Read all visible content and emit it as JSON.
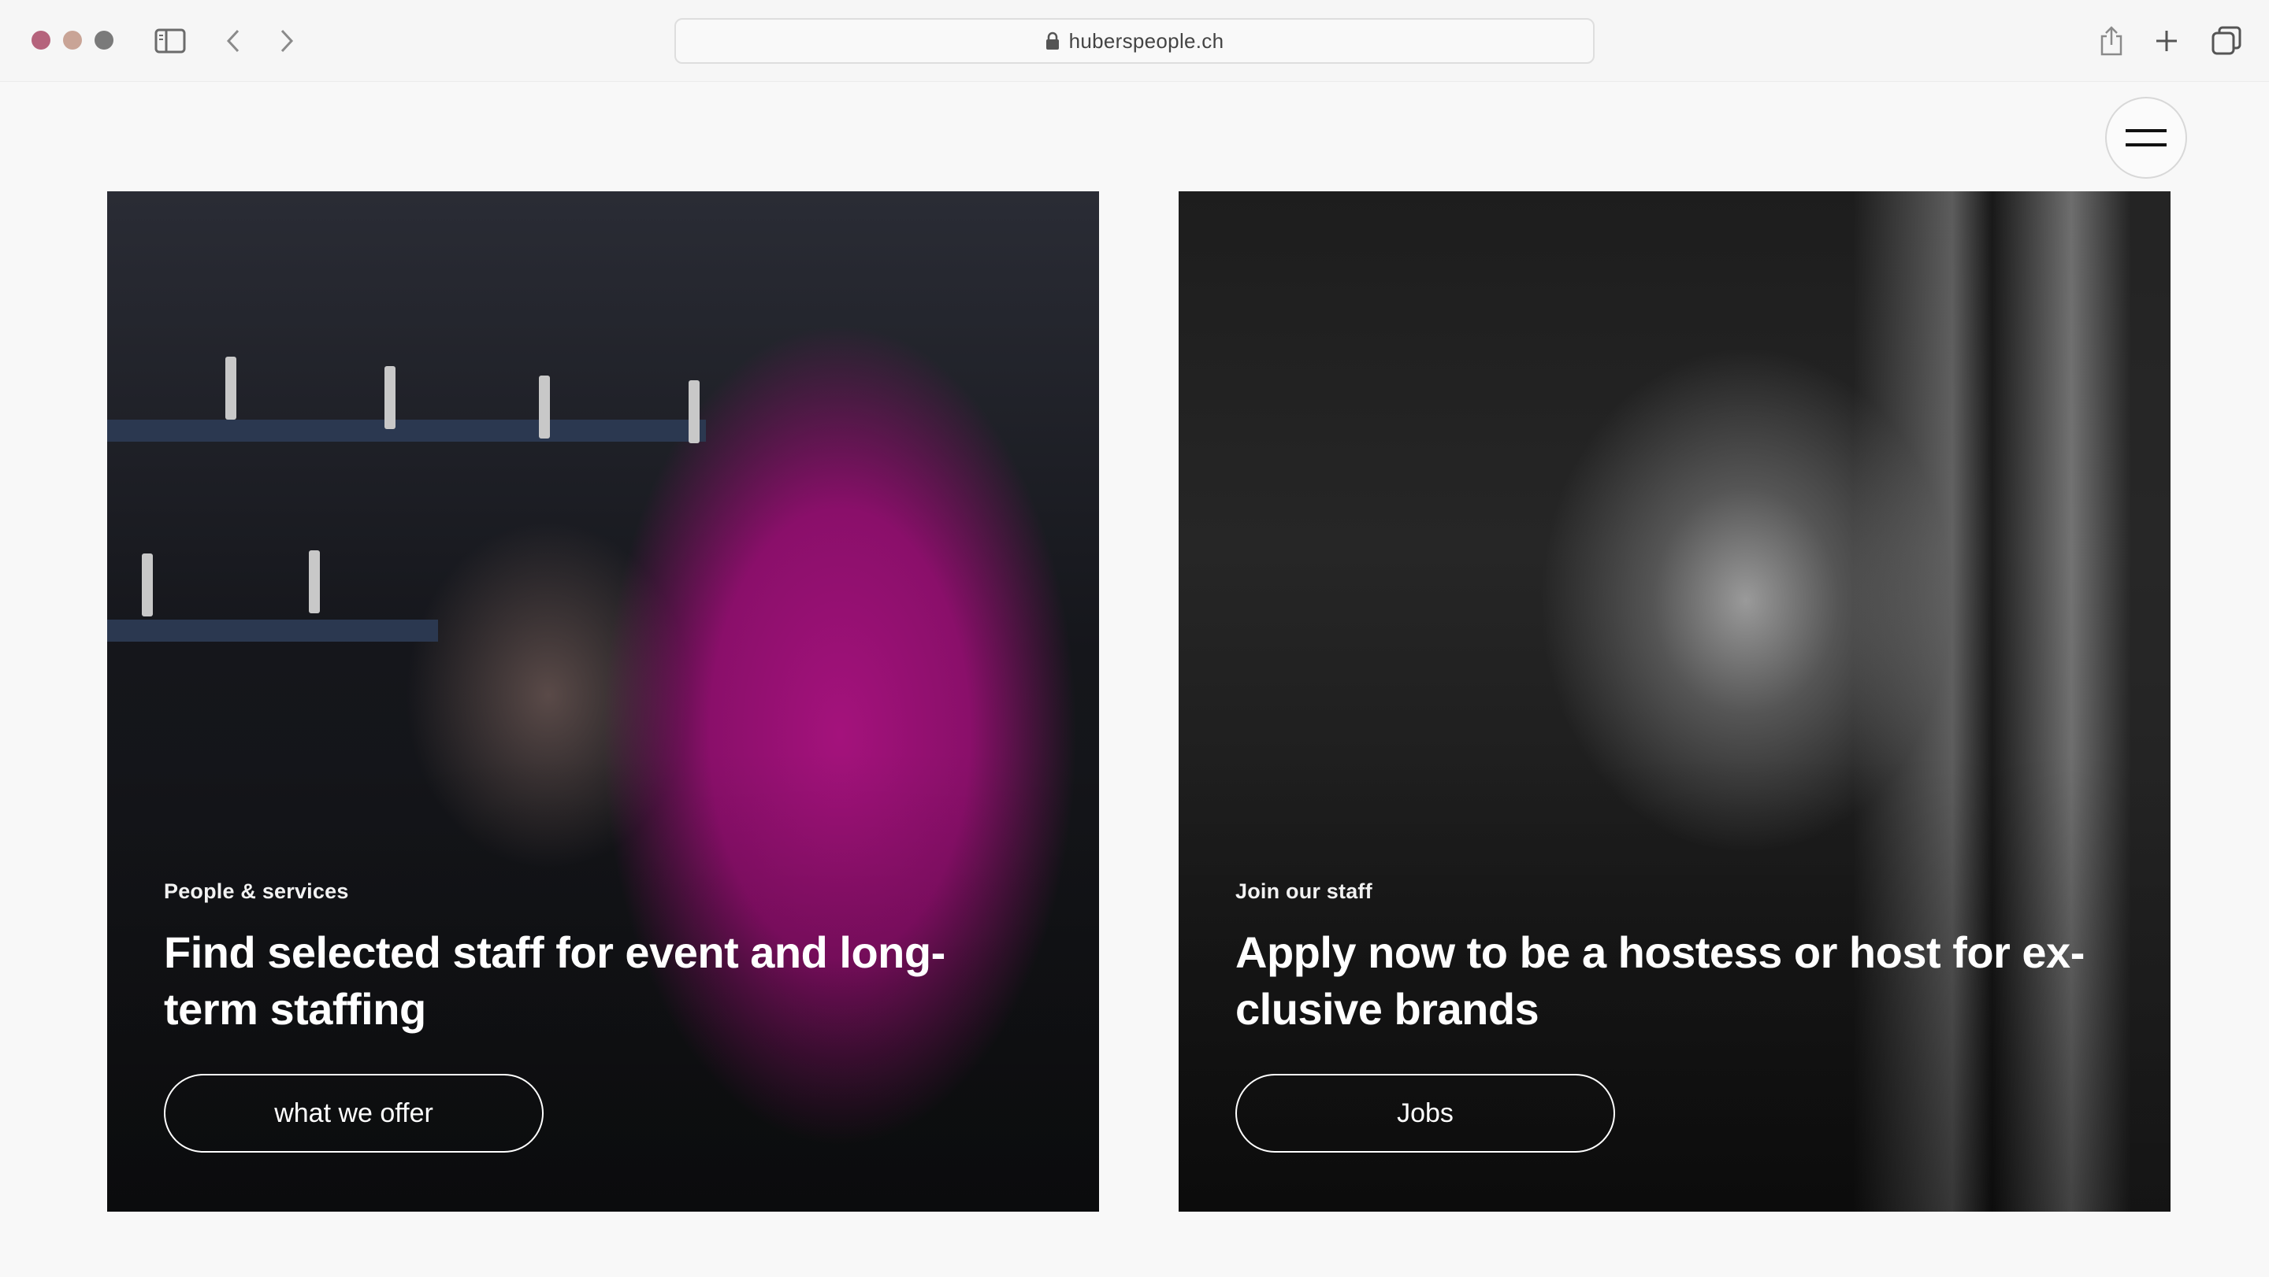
{
  "browser": {
    "url": "huberspeople.ch",
    "traffic_lights": [
      "close",
      "minimize",
      "maximize"
    ],
    "icons": {
      "sidebar": "sidebar-icon",
      "back": "chevron-left-icon",
      "forward": "chevron-right-icon",
      "lock": "lock-icon",
      "share": "share-icon",
      "new_tab": "plus-icon",
      "tabs": "tabs-overview-icon"
    }
  },
  "header": {
    "menu_icon": "hamburger-menu-icon"
  },
  "cards": [
    {
      "eyebrow": "People & services",
      "title": "Find selected staff for event and long-term staffing",
      "cta": "what we offer",
      "image": "woman holding magenta coat at clothing rack"
    },
    {
      "eyebrow": "Join our staff",
      "title": "Apply now to be a hostess or host for ex-clusive brands",
      "cta": "Jobs",
      "image": "man on phone, black and white"
    }
  ],
  "colors": {
    "page_bg": "#f8f8f8",
    "accent_magenta": "#a4127c",
    "text_on_image": "#ffffff"
  }
}
